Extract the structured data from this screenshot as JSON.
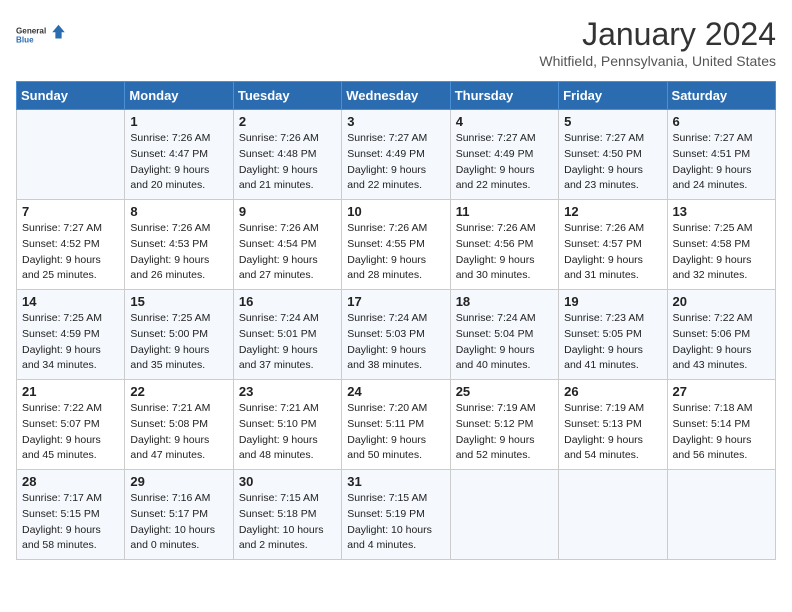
{
  "header": {
    "logo_line1": "General",
    "logo_line2": "Blue",
    "month": "January 2024",
    "location": "Whitfield, Pennsylvania, United States"
  },
  "days_of_week": [
    "Sunday",
    "Monday",
    "Tuesday",
    "Wednesday",
    "Thursday",
    "Friday",
    "Saturday"
  ],
  "weeks": [
    [
      {
        "day": "",
        "sunrise": "",
        "sunset": "",
        "daylight": ""
      },
      {
        "day": "1",
        "sunrise": "Sunrise: 7:26 AM",
        "sunset": "Sunset: 4:47 PM",
        "daylight": "Daylight: 9 hours and 20 minutes."
      },
      {
        "day": "2",
        "sunrise": "Sunrise: 7:26 AM",
        "sunset": "Sunset: 4:48 PM",
        "daylight": "Daylight: 9 hours and 21 minutes."
      },
      {
        "day": "3",
        "sunrise": "Sunrise: 7:27 AM",
        "sunset": "Sunset: 4:49 PM",
        "daylight": "Daylight: 9 hours and 22 minutes."
      },
      {
        "day": "4",
        "sunrise": "Sunrise: 7:27 AM",
        "sunset": "Sunset: 4:49 PM",
        "daylight": "Daylight: 9 hours and 22 minutes."
      },
      {
        "day": "5",
        "sunrise": "Sunrise: 7:27 AM",
        "sunset": "Sunset: 4:50 PM",
        "daylight": "Daylight: 9 hours and 23 minutes."
      },
      {
        "day": "6",
        "sunrise": "Sunrise: 7:27 AM",
        "sunset": "Sunset: 4:51 PM",
        "daylight": "Daylight: 9 hours and 24 minutes."
      }
    ],
    [
      {
        "day": "7",
        "sunrise": "Sunrise: 7:27 AM",
        "sunset": "Sunset: 4:52 PM",
        "daylight": "Daylight: 9 hours and 25 minutes."
      },
      {
        "day": "8",
        "sunrise": "Sunrise: 7:26 AM",
        "sunset": "Sunset: 4:53 PM",
        "daylight": "Daylight: 9 hours and 26 minutes."
      },
      {
        "day": "9",
        "sunrise": "Sunrise: 7:26 AM",
        "sunset": "Sunset: 4:54 PM",
        "daylight": "Daylight: 9 hours and 27 minutes."
      },
      {
        "day": "10",
        "sunrise": "Sunrise: 7:26 AM",
        "sunset": "Sunset: 4:55 PM",
        "daylight": "Daylight: 9 hours and 28 minutes."
      },
      {
        "day": "11",
        "sunrise": "Sunrise: 7:26 AM",
        "sunset": "Sunset: 4:56 PM",
        "daylight": "Daylight: 9 hours and 30 minutes."
      },
      {
        "day": "12",
        "sunrise": "Sunrise: 7:26 AM",
        "sunset": "Sunset: 4:57 PM",
        "daylight": "Daylight: 9 hours and 31 minutes."
      },
      {
        "day": "13",
        "sunrise": "Sunrise: 7:25 AM",
        "sunset": "Sunset: 4:58 PM",
        "daylight": "Daylight: 9 hours and 32 minutes."
      }
    ],
    [
      {
        "day": "14",
        "sunrise": "Sunrise: 7:25 AM",
        "sunset": "Sunset: 4:59 PM",
        "daylight": "Daylight: 9 hours and 34 minutes."
      },
      {
        "day": "15",
        "sunrise": "Sunrise: 7:25 AM",
        "sunset": "Sunset: 5:00 PM",
        "daylight": "Daylight: 9 hours and 35 minutes."
      },
      {
        "day": "16",
        "sunrise": "Sunrise: 7:24 AM",
        "sunset": "Sunset: 5:01 PM",
        "daylight": "Daylight: 9 hours and 37 minutes."
      },
      {
        "day": "17",
        "sunrise": "Sunrise: 7:24 AM",
        "sunset": "Sunset: 5:03 PM",
        "daylight": "Daylight: 9 hours and 38 minutes."
      },
      {
        "day": "18",
        "sunrise": "Sunrise: 7:24 AM",
        "sunset": "Sunset: 5:04 PM",
        "daylight": "Daylight: 9 hours and 40 minutes."
      },
      {
        "day": "19",
        "sunrise": "Sunrise: 7:23 AM",
        "sunset": "Sunset: 5:05 PM",
        "daylight": "Daylight: 9 hours and 41 minutes."
      },
      {
        "day": "20",
        "sunrise": "Sunrise: 7:22 AM",
        "sunset": "Sunset: 5:06 PM",
        "daylight": "Daylight: 9 hours and 43 minutes."
      }
    ],
    [
      {
        "day": "21",
        "sunrise": "Sunrise: 7:22 AM",
        "sunset": "Sunset: 5:07 PM",
        "daylight": "Daylight: 9 hours and 45 minutes."
      },
      {
        "day": "22",
        "sunrise": "Sunrise: 7:21 AM",
        "sunset": "Sunset: 5:08 PM",
        "daylight": "Daylight: 9 hours and 47 minutes."
      },
      {
        "day": "23",
        "sunrise": "Sunrise: 7:21 AM",
        "sunset": "Sunset: 5:10 PM",
        "daylight": "Daylight: 9 hours and 48 minutes."
      },
      {
        "day": "24",
        "sunrise": "Sunrise: 7:20 AM",
        "sunset": "Sunset: 5:11 PM",
        "daylight": "Daylight: 9 hours and 50 minutes."
      },
      {
        "day": "25",
        "sunrise": "Sunrise: 7:19 AM",
        "sunset": "Sunset: 5:12 PM",
        "daylight": "Daylight: 9 hours and 52 minutes."
      },
      {
        "day": "26",
        "sunrise": "Sunrise: 7:19 AM",
        "sunset": "Sunset: 5:13 PM",
        "daylight": "Daylight: 9 hours and 54 minutes."
      },
      {
        "day": "27",
        "sunrise": "Sunrise: 7:18 AM",
        "sunset": "Sunset: 5:14 PM",
        "daylight": "Daylight: 9 hours and 56 minutes."
      }
    ],
    [
      {
        "day": "28",
        "sunrise": "Sunrise: 7:17 AM",
        "sunset": "Sunset: 5:15 PM",
        "daylight": "Daylight: 9 hours and 58 minutes."
      },
      {
        "day": "29",
        "sunrise": "Sunrise: 7:16 AM",
        "sunset": "Sunset: 5:17 PM",
        "daylight": "Daylight: 10 hours and 0 minutes."
      },
      {
        "day": "30",
        "sunrise": "Sunrise: 7:15 AM",
        "sunset": "Sunset: 5:18 PM",
        "daylight": "Daylight: 10 hours and 2 minutes."
      },
      {
        "day": "31",
        "sunrise": "Sunrise: 7:15 AM",
        "sunset": "Sunset: 5:19 PM",
        "daylight": "Daylight: 10 hours and 4 minutes."
      },
      {
        "day": "",
        "sunrise": "",
        "sunset": "",
        "daylight": ""
      },
      {
        "day": "",
        "sunrise": "",
        "sunset": "",
        "daylight": ""
      },
      {
        "day": "",
        "sunrise": "",
        "sunset": "",
        "daylight": ""
      }
    ]
  ]
}
